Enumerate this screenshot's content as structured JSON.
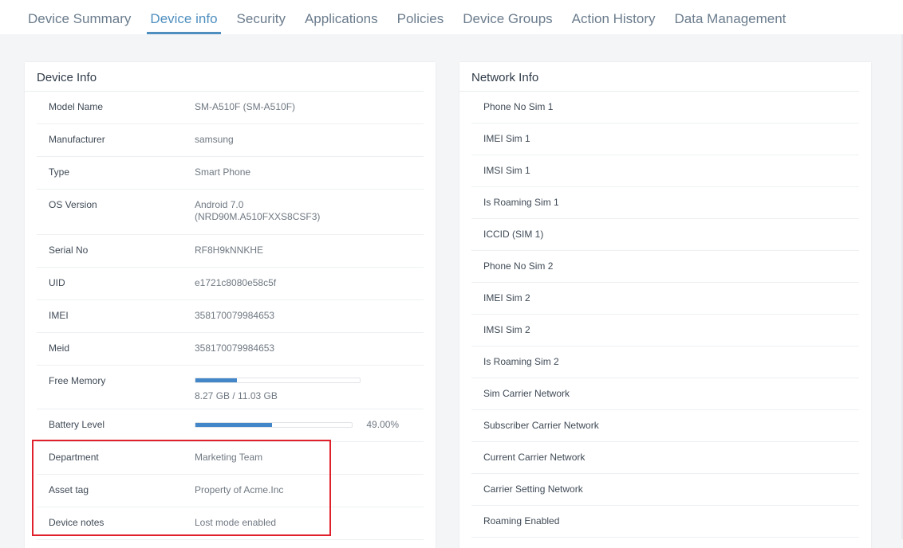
{
  "tabs": [
    {
      "label": "Device Summary"
    },
    {
      "label": "Device info"
    },
    {
      "label": "Security"
    },
    {
      "label": "Applications"
    },
    {
      "label": "Policies"
    },
    {
      "label": "Device Groups"
    },
    {
      "label": "Action History"
    },
    {
      "label": "Data Management"
    }
  ],
  "active_tab": "Device info",
  "device_info": {
    "title": "Device Info",
    "rows": [
      {
        "label": "Model Name",
        "value": "SM-A510F (SM-A510F)"
      },
      {
        "label": "Manufacturer",
        "value": "samsung"
      },
      {
        "label": "Type",
        "value": "Smart Phone"
      },
      {
        "label": "OS Version",
        "value_line1": "Android 7.0",
        "value_line2": "(NRD90M.A510FXXS8CSF3)"
      },
      {
        "label": "Serial No",
        "value": "RF8H9kNNKHE"
      },
      {
        "label": "UID",
        "value": "e1721c8080e58c5f"
      },
      {
        "label": "IMEI",
        "value": "358170079984653"
      },
      {
        "label": "Meid",
        "value": "358170079984653"
      }
    ],
    "free_memory": {
      "label": "Free Memory",
      "text": "8.27 GB / 11.03 GB",
      "fill_fraction": 0.25
    },
    "battery": {
      "label": "Battery Level",
      "text": "49.00%",
      "fill_fraction": 0.49
    },
    "extra_rows": [
      {
        "label": "Department",
        "value": "Marketing Team"
      },
      {
        "label": "Asset tag",
        "value": "Property of Acme.Inc"
      },
      {
        "label": "Device notes",
        "value": "Lost mode enabled"
      }
    ]
  },
  "network_info": {
    "title": "Network Info",
    "rows": [
      "Phone No Sim 1",
      "IMEI Sim 1",
      "IMSI Sim 1",
      "Is Roaming Sim 1",
      "ICCID (SIM 1)",
      "Phone No Sim 2",
      "IMEI Sim 2",
      "IMSI Sim 2",
      "Is Roaming Sim 2",
      "Sim Carrier Network",
      "Subscriber Carrier Network",
      "Current Carrier Network",
      "Carrier Setting Network",
      "Roaming Enabled"
    ]
  },
  "colors": {
    "accent": "#4f8fc0",
    "progress_fill": "#4387c9",
    "highlight_box": "#e0202a"
  }
}
